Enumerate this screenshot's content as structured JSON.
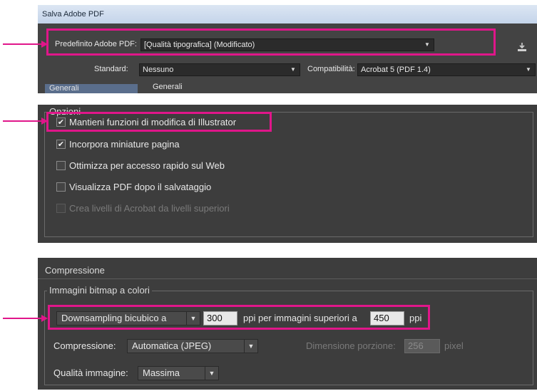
{
  "panel1": {
    "window_title": "Salva Adobe PDF",
    "preset_label": "Predefinito Adobe PDF:",
    "preset_value": "[Qualità tipografica] (Modificato)",
    "save_preset_icon": "download-icon",
    "standard_label": "Standard:",
    "standard_value": "Nessuno",
    "compat_label": "Compatibilità:",
    "compat_value": "Acrobat 5 (PDF 1.4)",
    "sidebar_tab": "Generali",
    "section_title": "Generali"
  },
  "panel2": {
    "group_title": "Opzioni",
    "options": [
      {
        "label": "Mantieni funzioni di modifica di Illustrator",
        "checked": true,
        "disabled": false
      },
      {
        "label": "Incorpora miniature pagina",
        "checked": true,
        "disabled": false
      },
      {
        "label": "Ottimizza per accesso rapido sul Web",
        "checked": false,
        "disabled": false
      },
      {
        "label": "Visualizza PDF dopo il salvataggio",
        "checked": false,
        "disabled": false
      },
      {
        "label": "Crea livelli di Acrobat da livelli superiori",
        "checked": false,
        "disabled": true
      }
    ]
  },
  "panel3": {
    "section_title": "Compressione",
    "group_title": "Immagini bitmap a colori",
    "downsampling_value": "Downsampling bicubico a",
    "resolution_value": "300",
    "ppi_above_label": "ppi per immagini superiori a",
    "above_value": "450",
    "ppi_label": "ppi",
    "compression_label": "Compressione:",
    "compression_value": "Automatica (JPEG)",
    "tile_size_label": "Dimensione porzione:",
    "tile_size_value": "256",
    "pixel_label": "pixel",
    "quality_label": "Qualità immagine:",
    "quality_value": "Massima"
  },
  "colors": {
    "highlight": "#e0168a",
    "panel_bg": "#3d3d3d"
  }
}
